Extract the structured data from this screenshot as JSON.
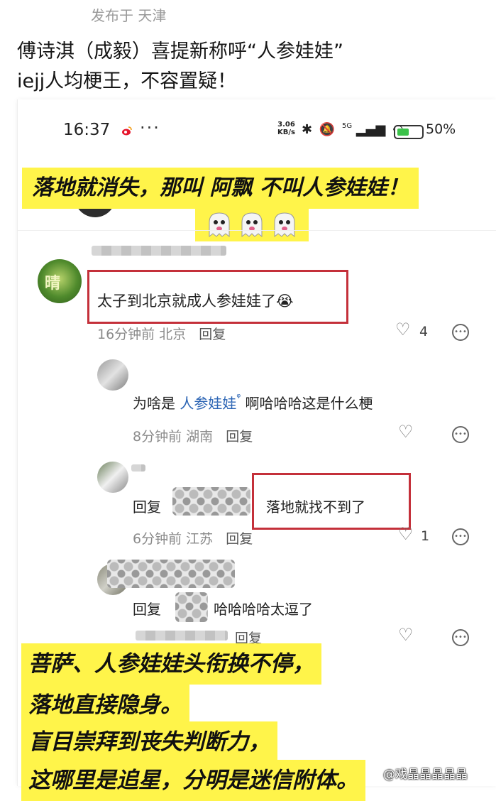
{
  "post": {
    "location": "发布于 天津",
    "text": "傅诗淇（成毅）喜提新称呼“人参娃娃”\niejj人均梗王，不容置疑！"
  },
  "status_bar": {
    "time": "16:37",
    "dots": "···",
    "net_speed_value": "3.06",
    "net_speed_unit": "KB/s",
    "signal": "5G",
    "battery_percent": "50%",
    "battery_level": 0.5
  },
  "banner_top": {
    "text": "落地就消失，那叫 阿飘 不叫人参娃娃！"
  },
  "comments": {
    "main": {
      "text": "太子到北京就成人参娃娃了",
      "emoji": "😭",
      "time": "16分钟前 北京",
      "reply": "回复",
      "likes": "4"
    },
    "reply1": {
      "prefix": "为啥是 ",
      "link": "人参娃娃",
      "link_mark": "ᵠ",
      "suffix": " 啊哈哈哈这是什么梗",
      "time": "8分钟前 湖南",
      "reply": "回复"
    },
    "reply2": {
      "label": "回复",
      "text": "落地就找不到了",
      "time": "6分钟前 江苏",
      "reply": "回复",
      "likes": "1"
    },
    "reply3": {
      "label": "回复",
      "text": "哈哈哈哈太逗了",
      "reply": "回复"
    }
  },
  "banner_bottom": {
    "lines": [
      "菩萨、人参娃娃头衔换不停，",
      "落地直接隐身。",
      "盲目崇拜到丧失判断力，",
      "这哪里是追星，分明是迷信附体。"
    ]
  },
  "watermark": "@戏晶晶晶晶晶",
  "colors": {
    "highlight": "#fff44a",
    "red_box": "#c4303a",
    "link": "#2b64b4"
  }
}
